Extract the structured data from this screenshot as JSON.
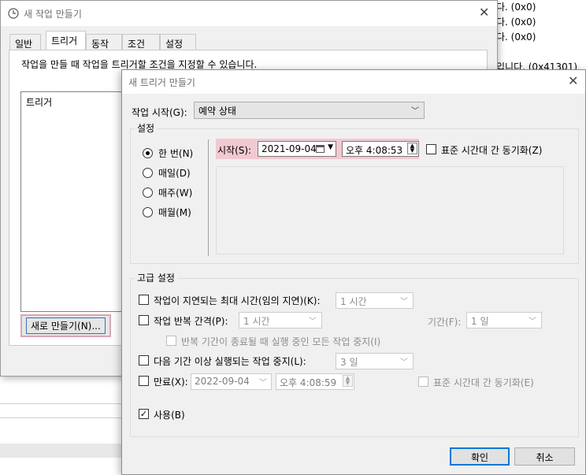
{
  "background_log": [
    "다. (0x0)",
    "다. (0x0)",
    "다. (0x0)",
    "입니다. (0x41301)"
  ],
  "task_dialog": {
    "title": "새 작업 만들기",
    "tabs": [
      "일반",
      "트리거",
      "동작",
      "조건",
      "설정"
    ],
    "active_tab": "트리거",
    "description": "작업을 만들 때 작업을 트리거할 조건을 지정할 수 있습니다.",
    "list_header": "트리거",
    "new_button": "새로 만들기(N)..."
  },
  "trigger_dialog": {
    "title": "새 트리거 만들기",
    "begin_label": "작업 시작(G):",
    "begin_value": "예약 상태",
    "settings_legend": "설정",
    "frequency_options": [
      "한 번(N)",
      "매일(D)",
      "매주(W)",
      "매월(M)"
    ],
    "frequency_selected": "한 번(N)",
    "start_label": "시작(S):",
    "start_date": "2021-09-04",
    "start_time": "오후  4:08:53",
    "sync_label": "표준 시간대 간 동기화(Z)",
    "advanced_legend": "고급 설정",
    "delay_label": "작업이 지연되는 최대 시간(임의 지연)(K):",
    "delay_value": "1 시간",
    "repeat_label": "작업 반복 간격(P):",
    "repeat_value": "1 시간",
    "duration_label": "기간(F):",
    "duration_value": "1 일",
    "stop_running_label": "반복 기간이 종료될 때 실행 중인 모든 작업 중지(I)",
    "stop_longer_label": "다음 기간 이상 실행되는 작업 중지(L):",
    "stop_longer_value": "3 일",
    "expire_label": "만료(X):",
    "expire_date": "2022-09-04",
    "expire_time": "오후   4:08:59",
    "expire_sync_label": "표준 시간대 간 동기화(E)",
    "enabled_label": "사용(B)",
    "enabled_checked": true,
    "ok_label": "확인",
    "cancel_label": "취소"
  },
  "colors": {
    "highlight": "#f2c9d2",
    "default_button_border": "#0078d7",
    "dialog_bg": "#f0f0f0"
  }
}
